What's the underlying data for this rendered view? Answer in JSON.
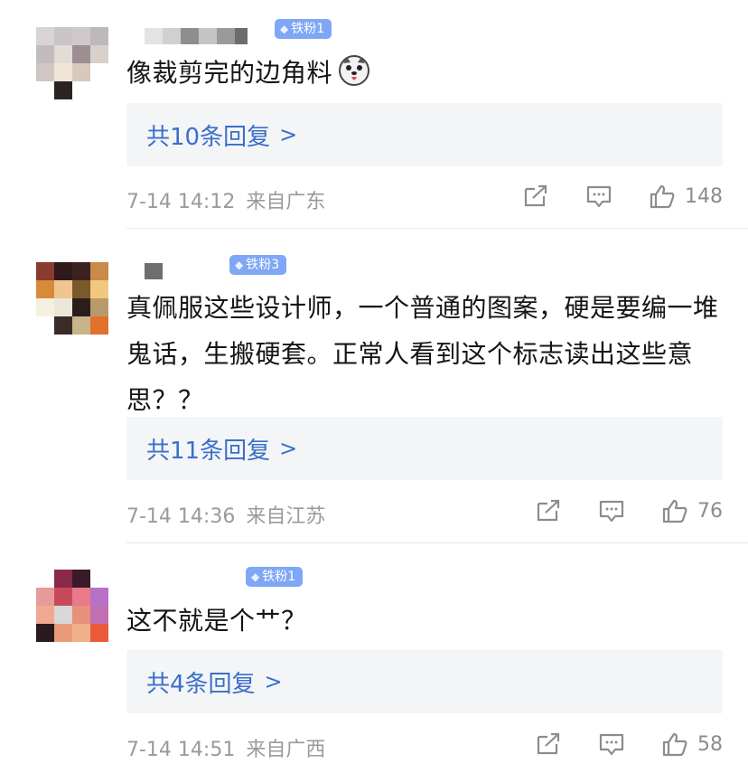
{
  "comments": [
    {
      "badge": "铁粉1",
      "text": "像裁剪完的边角料",
      "emoji": "dog-face-tongue-emoji",
      "reply_label": "共10条回复",
      "reply_chevron": ">",
      "date": "7-14 14:12",
      "location": "来自广东",
      "likes": "148"
    },
    {
      "badge": "铁粉3",
      "text": "真佩服这些设计师，一个普通的图案，硬是要编一堆鬼话，生搬硬套。正常人看到这个标志读出这些意思？？",
      "reply_label": "共11条回复",
      "reply_chevron": ">",
      "date": "7-14 14:36",
      "location": "来自江苏",
      "likes": "76"
    },
    {
      "badge": "铁粉1",
      "text": "这不就是个艹？",
      "reply_label": "共4条回复",
      "reply_chevron": ">",
      "date": "7-14 14:51",
      "location": "来自广西",
      "likes": "58"
    }
  ],
  "icons": {
    "share": "share-icon",
    "comment": "comment-icon",
    "like": "thumbs-up-icon",
    "badge": "diamond-icon"
  },
  "colors": {
    "link_blue": "#3b6fc9",
    "badge_blue": "#7fa7f5",
    "meta_gray": "#9a9a9a",
    "reply_bg": "#f4f5f7"
  }
}
